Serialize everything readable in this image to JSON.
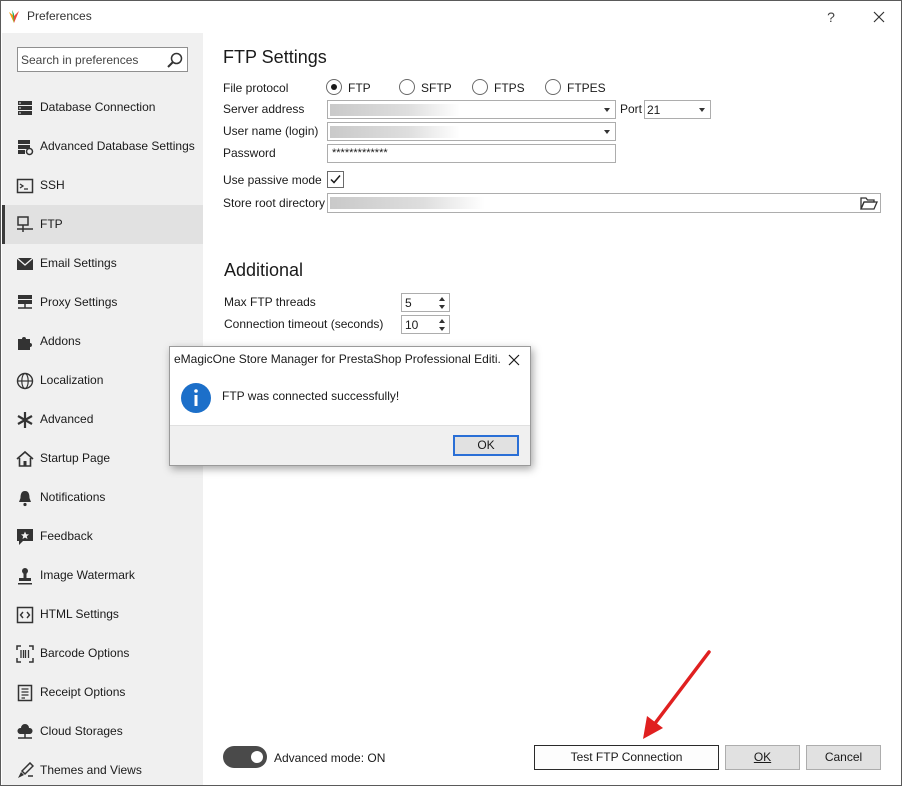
{
  "window": {
    "title": "Preferences",
    "help_glyph": "?"
  },
  "sidebar": {
    "search_placeholder": "Search in preferences",
    "items": [
      {
        "label": "Database Connection",
        "icon": "database-icon"
      },
      {
        "label": "Advanced Database Settings",
        "icon": "database-settings-icon"
      },
      {
        "label": "SSH",
        "icon": "terminal-icon"
      },
      {
        "label": "FTP",
        "icon": "network-icon",
        "active": true
      },
      {
        "label": "Email Settings",
        "icon": "envelope-icon"
      },
      {
        "label": "Proxy Settings",
        "icon": "server-icon"
      },
      {
        "label": "Addons",
        "icon": "puzzle-icon"
      },
      {
        "label": "Localization",
        "icon": "globe-icon"
      },
      {
        "label": "Advanced",
        "icon": "asterisk-icon"
      },
      {
        "label": "Startup Page",
        "icon": "home-icon"
      },
      {
        "label": "Notifications",
        "icon": "bell-icon"
      },
      {
        "label": "Feedback",
        "icon": "star-comment-icon"
      },
      {
        "label": "Image Watermark",
        "icon": "stamp-icon"
      },
      {
        "label": "HTML Settings",
        "icon": "code-icon"
      },
      {
        "label": "Barcode Options",
        "icon": "barcode-icon"
      },
      {
        "label": "Receipt Options",
        "icon": "receipt-icon"
      },
      {
        "label": "Cloud Storages",
        "icon": "cloud-icon"
      },
      {
        "label": "Themes and Views",
        "icon": "paint-icon"
      }
    ]
  },
  "ftp": {
    "title": "FTP Settings",
    "file_protocol_label": "File protocol",
    "protocols": [
      "FTP",
      "SFTP",
      "FTPS",
      "FTPES"
    ],
    "selected_protocol": "FTP",
    "server_address_label": "Server address",
    "port_label": "Port",
    "port_value": "21",
    "username_label": "User name (login)",
    "password_label": "Password",
    "password_value": "*************",
    "passive_label": "Use passive mode",
    "passive_checked": true,
    "root_dir_label": "Store root directory"
  },
  "additional": {
    "title": "Additional",
    "threads_label": "Max FTP threads",
    "threads_value": "5",
    "timeout_label": "Connection timeout (seconds)",
    "timeout_value": "10"
  },
  "bottom": {
    "advanced_mode_label": "Advanced mode: ON",
    "test_button": "Test FTP Connection",
    "ok_button": "OK",
    "cancel_button": "Cancel"
  },
  "dialog": {
    "title": "eMagicOne Store Manager for PrestaShop Professional Editi...",
    "message": "FTP was connected successfully!",
    "ok_button": "OK"
  },
  "colors": {
    "accent": "#2a6fd6",
    "arrow": "#e02020",
    "info_icon": "#1c6fc9"
  }
}
